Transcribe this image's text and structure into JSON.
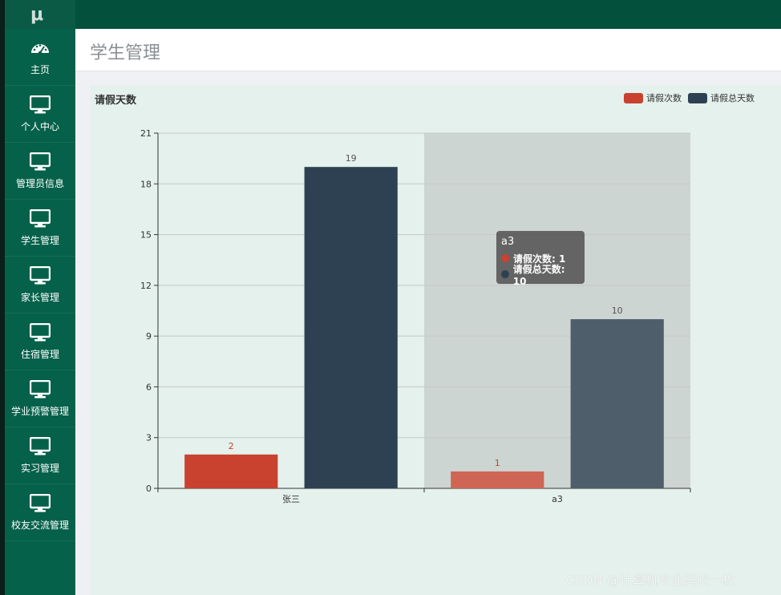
{
  "app": {
    "logo": "μ"
  },
  "sidebar": {
    "items": [
      {
        "label": "主页",
        "icon": "dashboard-icon"
      },
      {
        "label": "个人中心",
        "icon": "monitor-icon"
      },
      {
        "label": "管理员信息",
        "icon": "monitor-icon"
      },
      {
        "label": "学生管理",
        "icon": "monitor-icon"
      },
      {
        "label": "家长管理",
        "icon": "monitor-icon"
      },
      {
        "label": "住宿管理",
        "icon": "monitor-icon"
      },
      {
        "label": "学业预警管理",
        "icon": "monitor-icon"
      },
      {
        "label": "实习管理",
        "icon": "monitor-icon"
      },
      {
        "label": "校友交流管理",
        "icon": "monitor-icon"
      }
    ]
  },
  "header": {
    "title": "学生管理"
  },
  "chart_data": {
    "type": "bar",
    "title": "请假天数",
    "categories": [
      "张三",
      "a3"
    ],
    "series": [
      {
        "name": "请假次数",
        "values": [
          2,
          1
        ],
        "color": "#c9412f"
      },
      {
        "name": "请假总天数",
        "values": [
          19,
          10
        ],
        "color": "#2d4152"
      }
    ],
    "ylim": [
      0,
      21
    ],
    "yticks": [
      0,
      3,
      6,
      9,
      12,
      15,
      18,
      21
    ],
    "grid": true,
    "legend": "top-right",
    "highlighted_category": "a3"
  },
  "tooltip": {
    "title": "a3",
    "rows": [
      {
        "text": "请假次数: 1",
        "color": "#c9412f"
      },
      {
        "text": "请假总天数: 10",
        "color": "#2d4152"
      }
    ]
  },
  "watermark": "CSDN @计算机专业码农一枚"
}
